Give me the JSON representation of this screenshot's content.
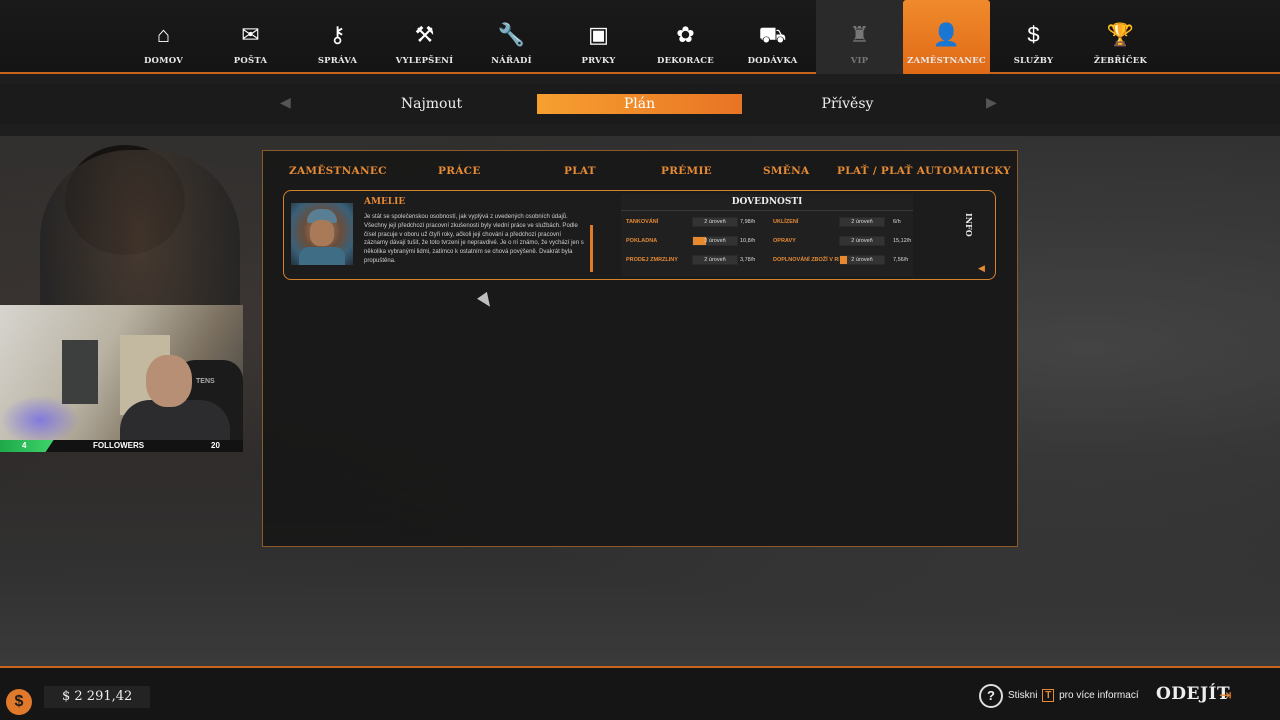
{
  "nav": {
    "items": [
      {
        "label": "DOMOV",
        "icon": "⌂",
        "name": "nav-home",
        "icon_name": "home-icon"
      },
      {
        "label": "POŠTA",
        "icon": "✉",
        "name": "nav-mail",
        "icon_name": "mail-icon"
      },
      {
        "label": "SPRÁVA",
        "icon": "⚷",
        "name": "nav-management",
        "icon_name": "key-icon"
      },
      {
        "label": "VYLEPŠENÍ",
        "icon": "⚒",
        "name": "nav-upgrades",
        "icon_name": "hammer-icon"
      },
      {
        "label": "NÁŘADÍ",
        "icon": "🔧",
        "name": "nav-tools",
        "icon_name": "wrench-icon"
      },
      {
        "label": "PRVKY",
        "icon": "▣",
        "name": "nav-elements",
        "icon_name": "door-icon"
      },
      {
        "label": "DEKORACE",
        "icon": "✿",
        "name": "nav-decoration",
        "icon_name": "flower-icon"
      },
      {
        "label": "DODÁVKA",
        "icon": "⛟",
        "name": "nav-delivery",
        "icon_name": "truck-icon"
      },
      {
        "label": "VIP",
        "icon": "♜",
        "name": "nav-vip",
        "icon_name": "hat-icon"
      },
      {
        "label": "ZAMĚSTNANEC",
        "icon": "👤",
        "name": "nav-employee",
        "icon_name": "person-icon"
      },
      {
        "label": "SLUŽBY",
        "icon": "$",
        "name": "nav-services",
        "icon_name": "money-hand-icon"
      },
      {
        "label": "ŽEBŘÍČEK",
        "icon": "🏆",
        "name": "nav-leaderboard",
        "icon_name": "trophy-icon"
      }
    ],
    "active_index": 9
  },
  "subtabs": {
    "left": "Najmout",
    "center": "Plán",
    "right": "Přívěsy"
  },
  "table": {
    "headers": [
      "ZAMĚSTNANEC",
      "PRÁCE",
      "PLAT",
      "PRÉMIE",
      "SMĚNA",
      "PLAŤ / PLAŤ AUTOMATICKY"
    ]
  },
  "employee": {
    "name": "AMELIE",
    "bio": "Je stát se společenskou osobností, jak vyplývá z uvedených osobních údajů. Všechny její předchozí pracovní zkušenosti byly vlední práce ve službách. Podle čísel pracuje v oboru už čtyři roky, ačkoli její chování a předchozí pracovní záznamy dávají tušit, že toto tvrzení je nepravdivé. Je o ní známo, že vychází jen s několika vybranými lidmi, zatímco k ostatním se chová povýšeně. Dvakrát byla propuštěna.",
    "skills_title": "DOVEDNOSTI",
    "info_label": "INFO",
    "skills": [
      {
        "name": "TANKOVÁNÍ",
        "level": "2 úroveň",
        "rate": "7,98/h",
        "progress": 0
      },
      {
        "name": "POKLADNA",
        "level": "3 úroveň",
        "rate": "10,8/h",
        "progress": 0.3
      },
      {
        "name": "PRODEJ ZMRZLINY",
        "level": "2 úroveň",
        "rate": "3,78/h",
        "progress": 0
      },
      {
        "name": "UKLÍZENÍ",
        "level": "2 úroveň",
        "rate": "6/h",
        "progress": 0
      },
      {
        "name": "OPRAVY",
        "level": "2 úroveň",
        "rate": "15,12/h",
        "progress": 0
      },
      {
        "name": "DOPLNOVÁNÍ ZBOŽÍ V REGÁLECH",
        "level": "2 úroveň",
        "rate": "7,56/h",
        "progress": 0.15
      }
    ]
  },
  "webcam": {
    "followers_count": "4",
    "followers_label": "FOLLOWERS",
    "followers_goal": "20",
    "followers_progress": 0.2,
    "chair_text": "TENS"
  },
  "footer": {
    "currency_icon": "$",
    "money": "$ 2 291,42",
    "help_icon": "?",
    "help_prefix": "Stiskni",
    "help_key": "T",
    "help_suffix": "pro více informací",
    "exit_label": "ODEJÍT"
  },
  "colors": {
    "accent": "#e58a35",
    "active_nav": "#f08a2c",
    "border": "#c8641e"
  }
}
